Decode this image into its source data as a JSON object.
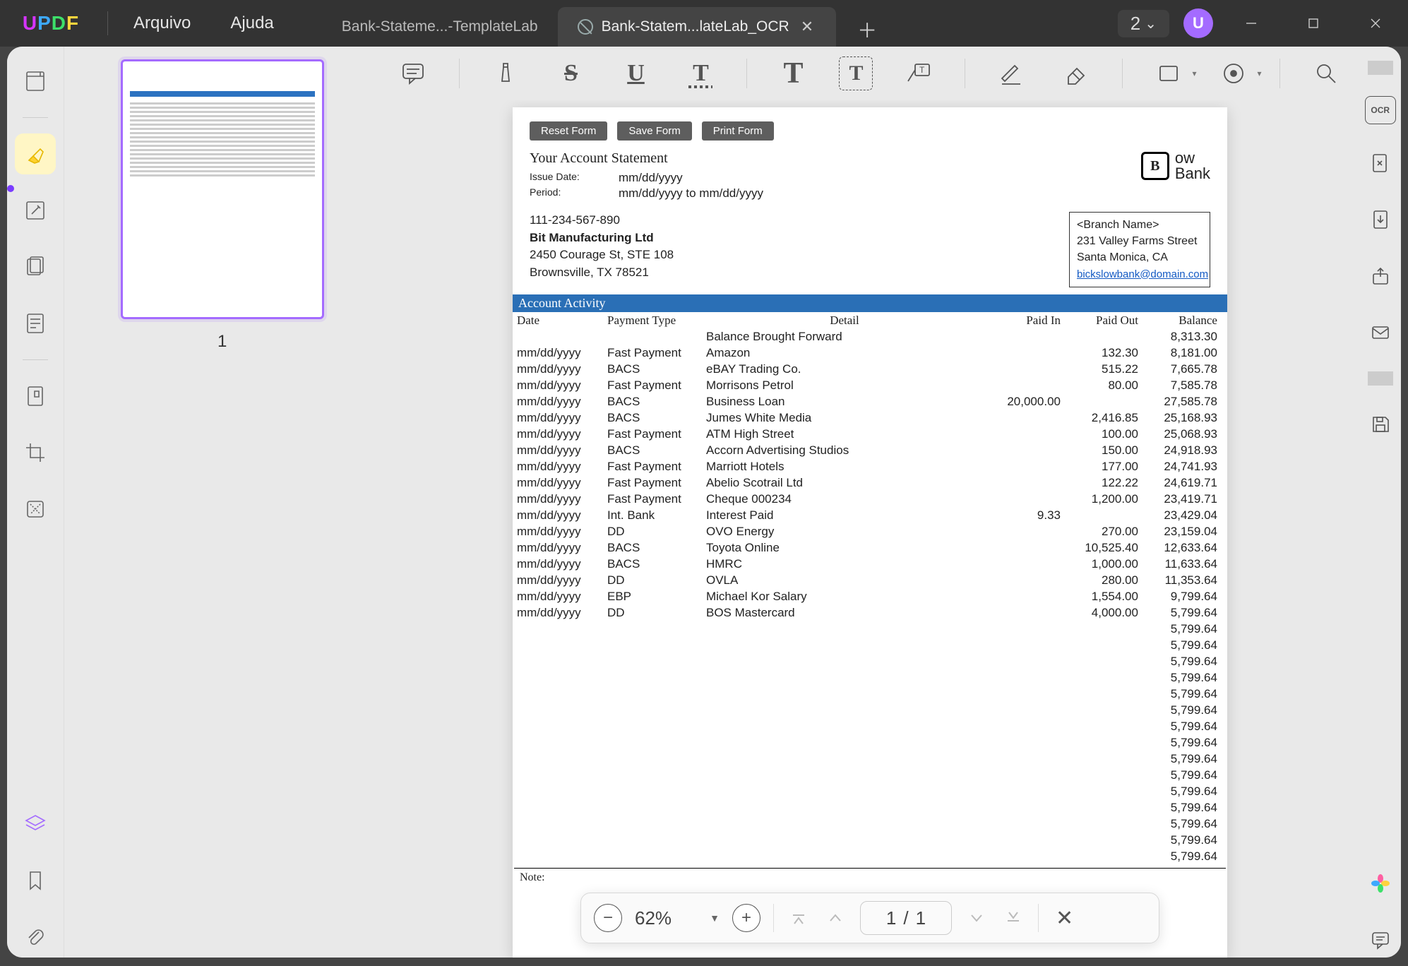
{
  "app": {
    "logo_letters": [
      "U",
      "P",
      "D",
      "F"
    ],
    "menus": {
      "file": "Arquivo",
      "help": "Ajuda"
    },
    "tabs": {
      "inactive": "Bank-Stateme...-TemplateLab",
      "active": "Bank-Statem...lateLab_OCR"
    },
    "tab_count": "2",
    "avatar_initial": "U"
  },
  "thumbnail": {
    "page_label": "1"
  },
  "doc": {
    "buttons": {
      "reset": "Reset Form",
      "save": "Save Form",
      "print": "Print Form"
    },
    "title": "Your Account Statement",
    "issue_date_label": "Issue Date:",
    "issue_date": "mm/dd/yyyy",
    "period_label": "Period:",
    "period": "mm/dd/yyyy to mm/dd/yyyy",
    "bank_name_line1": "ow",
    "bank_name_line2": "Bank",
    "bank_mark": "B",
    "account_phone": "111-234-567-890",
    "account_name": "Bit Manufacturing Ltd",
    "account_addr1": "2450 Courage St, STE 108",
    "account_addr2": "Brownsville, TX 78521",
    "branch_name": "<Branch Name>",
    "branch_addr1": "231 Valley Farms Street",
    "branch_addr2": "Santa Monica, CA",
    "branch_email": "bickslowbank@domain.com",
    "activity_header": "Account Activity",
    "columns": {
      "date": "Date",
      "pt": "Payment Type",
      "detail": "Detail",
      "in": "Paid In",
      "out": "Paid Out",
      "bal": "Balance"
    },
    "rows": [
      {
        "date": "",
        "pt": "",
        "detail": "Balance Brought Forward",
        "in": "",
        "out": "",
        "bal": "8,313.30"
      },
      {
        "date": "mm/dd/yyyy",
        "pt": "Fast Payment",
        "detail": "Amazon",
        "in": "",
        "out": "132.30",
        "bal": "8,181.00"
      },
      {
        "date": "mm/dd/yyyy",
        "pt": "BACS",
        "detail": "eBAY Trading Co.",
        "in": "",
        "out": "515.22",
        "bal": "7,665.78"
      },
      {
        "date": "mm/dd/yyyy",
        "pt": "Fast Payment",
        "detail": "Morrisons Petrol",
        "in": "",
        "out": "80.00",
        "bal": "7,585.78"
      },
      {
        "date": "mm/dd/yyyy",
        "pt": "BACS",
        "detail": "Business Loan",
        "in": "20,000.00",
        "out": "",
        "bal": "27,585.78"
      },
      {
        "date": "mm/dd/yyyy",
        "pt": "BACS",
        "detail": "Jumes White Media",
        "in": "",
        "out": "2,416.85",
        "bal": "25,168.93"
      },
      {
        "date": "mm/dd/yyyy",
        "pt": "Fast Payment",
        "detail": "ATM High Street",
        "in": "",
        "out": "100.00",
        "bal": "25,068.93"
      },
      {
        "date": "mm/dd/yyyy",
        "pt": "BACS",
        "detail": "Accorn Advertising Studios",
        "in": "",
        "out": "150.00",
        "bal": "24,918.93"
      },
      {
        "date": "mm/dd/yyyy",
        "pt": "Fast Payment",
        "detail": "Marriott Hotels",
        "in": "",
        "out": "177.00",
        "bal": "24,741.93"
      },
      {
        "date": "mm/dd/yyyy",
        "pt": "Fast Payment",
        "detail": "Abelio Scotrail Ltd",
        "in": "",
        "out": "122.22",
        "bal": "24,619.71"
      },
      {
        "date": "mm/dd/yyyy",
        "pt": "Fast Payment",
        "detail": "Cheque 000234",
        "in": "",
        "out": "1,200.00",
        "bal": "23,419.71"
      },
      {
        "date": "mm/dd/yyyy",
        "pt": "Int. Bank",
        "detail": "Interest Paid",
        "in": "9.33",
        "out": "",
        "bal": "23,429.04"
      },
      {
        "date": "mm/dd/yyyy",
        "pt": "DD",
        "detail": "OVO Energy",
        "in": "",
        "out": "270.00",
        "bal": "23,159.04"
      },
      {
        "date": "mm/dd/yyyy",
        "pt": "BACS",
        "detail": "Toyota Online",
        "in": "",
        "out": "10,525.40",
        "bal": "12,633.64"
      },
      {
        "date": "mm/dd/yyyy",
        "pt": "BACS",
        "detail": "HMRC",
        "in": "",
        "out": "1,000.00",
        "bal": "11,633.64"
      },
      {
        "date": "mm/dd/yyyy",
        "pt": "DD",
        "detail": "OVLA",
        "in": "",
        "out": "280.00",
        "bal": "11,353.64"
      },
      {
        "date": "mm/dd/yyyy",
        "pt": "EBP",
        "detail": "Michael Kor Salary",
        "in": "",
        "out": "1,554.00",
        "bal": "9,799.64"
      },
      {
        "date": "mm/dd/yyyy",
        "pt": "DD",
        "detail": "BOS Mastercard",
        "in": "",
        "out": "4,000.00",
        "bal": "5,799.64"
      },
      {
        "date": "",
        "pt": "",
        "detail": "",
        "in": "",
        "out": "",
        "bal": "5,799.64"
      },
      {
        "date": "",
        "pt": "",
        "detail": "",
        "in": "",
        "out": "",
        "bal": "5,799.64"
      },
      {
        "date": "",
        "pt": "",
        "detail": "",
        "in": "",
        "out": "",
        "bal": "5,799.64"
      },
      {
        "date": "",
        "pt": "",
        "detail": "",
        "in": "",
        "out": "",
        "bal": "5,799.64"
      },
      {
        "date": "",
        "pt": "",
        "detail": "",
        "in": "",
        "out": "",
        "bal": "5,799.64"
      },
      {
        "date": "",
        "pt": "",
        "detail": "",
        "in": "",
        "out": "",
        "bal": "5,799.64"
      },
      {
        "date": "",
        "pt": "",
        "detail": "",
        "in": "",
        "out": "",
        "bal": "5,799.64"
      },
      {
        "date": "",
        "pt": "",
        "detail": "",
        "in": "",
        "out": "",
        "bal": "5,799.64"
      },
      {
        "date": "",
        "pt": "",
        "detail": "",
        "in": "",
        "out": "",
        "bal": "5,799.64"
      },
      {
        "date": "",
        "pt": "",
        "detail": "",
        "in": "",
        "out": "",
        "bal": "5,799.64"
      },
      {
        "date": "",
        "pt": "",
        "detail": "",
        "in": "",
        "out": "",
        "bal": "5,799.64"
      },
      {
        "date": "",
        "pt": "",
        "detail": "",
        "in": "",
        "out": "",
        "bal": "5,799.64"
      },
      {
        "date": "",
        "pt": "",
        "detail": "",
        "in": "",
        "out": "",
        "bal": "5,799.64"
      },
      {
        "date": "",
        "pt": "",
        "detail": "",
        "in": "",
        "out": "",
        "bal": "5,799.64"
      },
      {
        "date": "",
        "pt": "",
        "detail": "",
        "in": "",
        "out": "",
        "bal": "5,799.64"
      }
    ],
    "note_label": "Note:"
  },
  "page_toolbar": {
    "zoom": "62%",
    "page_current": "1",
    "page_sep": "/",
    "page_total": "1"
  },
  "right_rail": {
    "ocr_label": "OCR"
  }
}
